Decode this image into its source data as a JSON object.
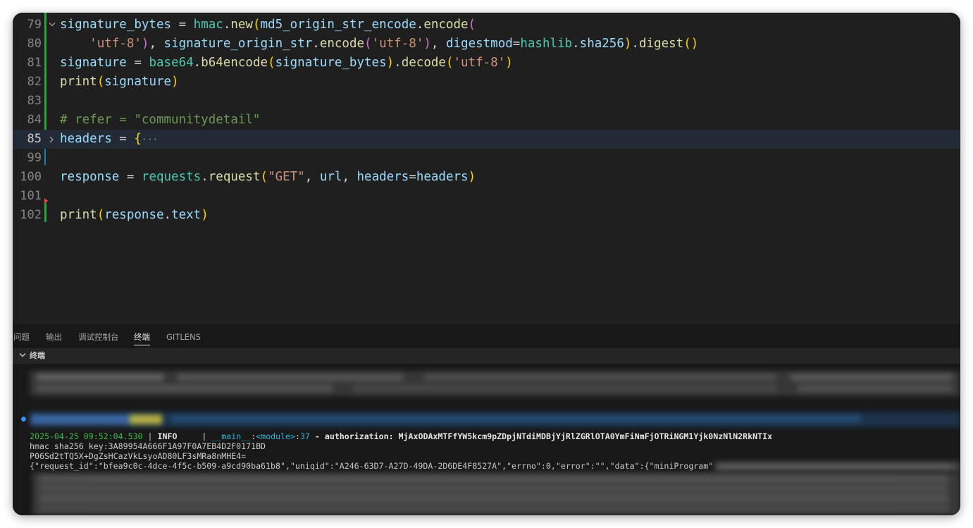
{
  "editor": {
    "lines": [
      {
        "num": "79"
      },
      {
        "num": "80"
      },
      {
        "num": "81"
      },
      {
        "num": "82"
      },
      {
        "num": "83"
      },
      {
        "num": "84"
      },
      {
        "num": "85"
      },
      {
        "num": "99"
      },
      {
        "num": "100"
      },
      {
        "num": "101"
      },
      {
        "num": "102"
      }
    ],
    "code": {
      "l79_var": "signature_bytes",
      "l79_eq": " = ",
      "l79_mod": "hmac",
      "l79_fn": "new",
      "l79_arg": "md5_origin_str_encode",
      "l79_fn2": "encode",
      "l80_s": "'utf-8'",
      "l80_var": "signature_origin_str",
      "l80_fn": "encode",
      "l80_s2": "'utf-8'",
      "l80_kw": "digestmod",
      "l80_mod": "hashlib",
      "l80_attr": "sha256",
      "l80_fn2": "digest",
      "l81_var": "signature",
      "l81_mod": "base64",
      "l81_fn": "b64encode",
      "l81_arg": "signature_bytes",
      "l81_fn2": "decode",
      "l81_s": "'utf-8'",
      "l82_fn": "print",
      "l82_arg": "signature",
      "l84_comment": "# refer = \"communitydetail\"",
      "l85_var": "headers",
      "l85_rest": " = ",
      "l85_brace": "{",
      "l85_ellipsis": "···",
      "l100_var": "response",
      "l100_mod": "requests",
      "l100_fn": "request",
      "l100_s": "\"GET\"",
      "l100_arg1": "url",
      "l100_kw": "headers",
      "l100_arg2": "headers",
      "l102_fn": "print",
      "l102_arg": "response",
      "l102_attr": "text"
    }
  },
  "panel": {
    "tabs": [
      "问题",
      "输出",
      "调试控制台",
      "终端",
      "GITLENS"
    ],
    "active_tab": "终端",
    "terminal_title": "终端",
    "log": {
      "timestamp": "2025-04-25 09:52:04.530",
      "sep1": " | ",
      "level": "INFO    ",
      "sep2": " | ",
      "module": "__main__",
      "colon1": ":",
      "func": "<module>",
      "colon2": ":",
      "lineno": "37",
      "message": " - authorization: MjAxODAxMTFfYW5kcm9pZDpjNTdiMDBjYjRlZGRlOTA0YmFiNmFjOTRiNGM1Yjk0NzNlN2RkNTIx"
    },
    "line2": "hmac sha256 key:3A89954A666F1A97F0A7EB4D2F0171BD",
    "line3": "P06Sd2tTQ5X+DgZsHCazVkLsyoAD80LF3sMRa8nMHE4=",
    "line4": "{\"request_id\":\"bfea9c0c-4dce-4f5c-b509-a9cd90ba61b8\",\"uniqid\":\"A246-63D7-A27D-49DA-2D6DE4F8527A\",\"errno\":0,\"error\":\"\",\"data\":{\"miniProgram\""
  },
  "colors": {
    "editor_bg": "#1f1f1f",
    "panel_bg": "#181818",
    "modified_gutter": "#2ea043",
    "accent": "#3794ff"
  }
}
